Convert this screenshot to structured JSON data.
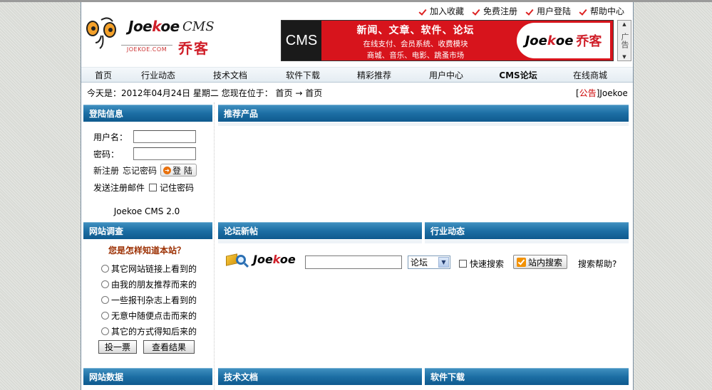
{
  "toplinks": [
    "加入收藏",
    "免费注册",
    "用户登陆",
    "帮助中心"
  ],
  "logo": {
    "word_pre": "Joe",
    "word_k": "k",
    "word_post": "oe",
    "cms": "CMS",
    "cn": "乔客",
    "url": "JOEKOE.COM"
  },
  "banner": {
    "left": "CMS",
    "line1": "新闻、文章、软件、论坛",
    "line2": "在线支付、会员系统、收费模块",
    "line3": "商城、音乐、电影、跳蚤市场",
    "brand_pre": "Joe",
    "brand_k": "k",
    "brand_post": "oe",
    "brand_cn": "乔客"
  },
  "ad_label": "广告",
  "nav": [
    "首页",
    "行业动态",
    "技术文档",
    "软件下载",
    "精彩推荐",
    "用户中心",
    "CMS论坛",
    "在线商城"
  ],
  "info": {
    "text": "今天是：2012年04月24日 星期二  您现在位于： 首页 → 首页",
    "notice_tag": "公告",
    "notice_text": "Joekoe"
  },
  "login": {
    "title": "登陆信息",
    "username_label": "用户名：",
    "password_label": "密码：",
    "register": "新注册",
    "forgot": "忘记密码",
    "login_button": "登 陆",
    "send_mail": "发送注册邮件",
    "remember": "记住密码",
    "version": "Joekoe CMS 2.0"
  },
  "recommend_title": "推荐产品",
  "survey": {
    "title": "网站调查",
    "question": "您是怎样知道本站？",
    "options": [
      "其它网站链接上看到的",
      "由我的朋友推荐而来的",
      "一些报刊杂志上看到的",
      "无意中随便点击而来的",
      "其它的方式得知后来的"
    ],
    "vote": "投一票",
    "results": "查看结果"
  },
  "forum_new_title": "论坛新帖",
  "industry_title": "行业动态",
  "search": {
    "brand_pre": "Joe",
    "brand_k": "k",
    "brand_post": "oe",
    "scope": "论坛",
    "quick": "快速搜索",
    "site_search": "站内搜索",
    "help": "搜索帮助?"
  },
  "bottom": {
    "site_data": "网站数据",
    "tech_docs": "技术文档",
    "software": "软件下载"
  },
  "colors": {
    "header_blue": "#1c6ea4",
    "accent_red": "#d7141c",
    "survey_question": "#9b2e00"
  }
}
